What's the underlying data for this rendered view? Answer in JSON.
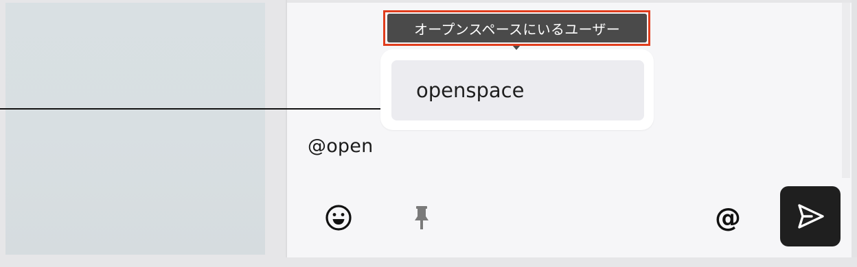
{
  "tooltip": {
    "text": "オープンスペースにいるユーザー"
  },
  "mention_suggestions": {
    "items": [
      {
        "label": "openspace"
      }
    ]
  },
  "composer": {
    "text": "@open"
  },
  "toolbar": {
    "emoji_icon": "emoji-smile-icon",
    "pin_icon": "pin-icon",
    "mention_label": "@",
    "send_icon": "send-icon"
  },
  "colors": {
    "tooltip_bg": "#4a4a4a",
    "highlight": "#e03c1c",
    "send_bg": "#1f1f1f",
    "suggestion_bg": "#ececf0"
  }
}
